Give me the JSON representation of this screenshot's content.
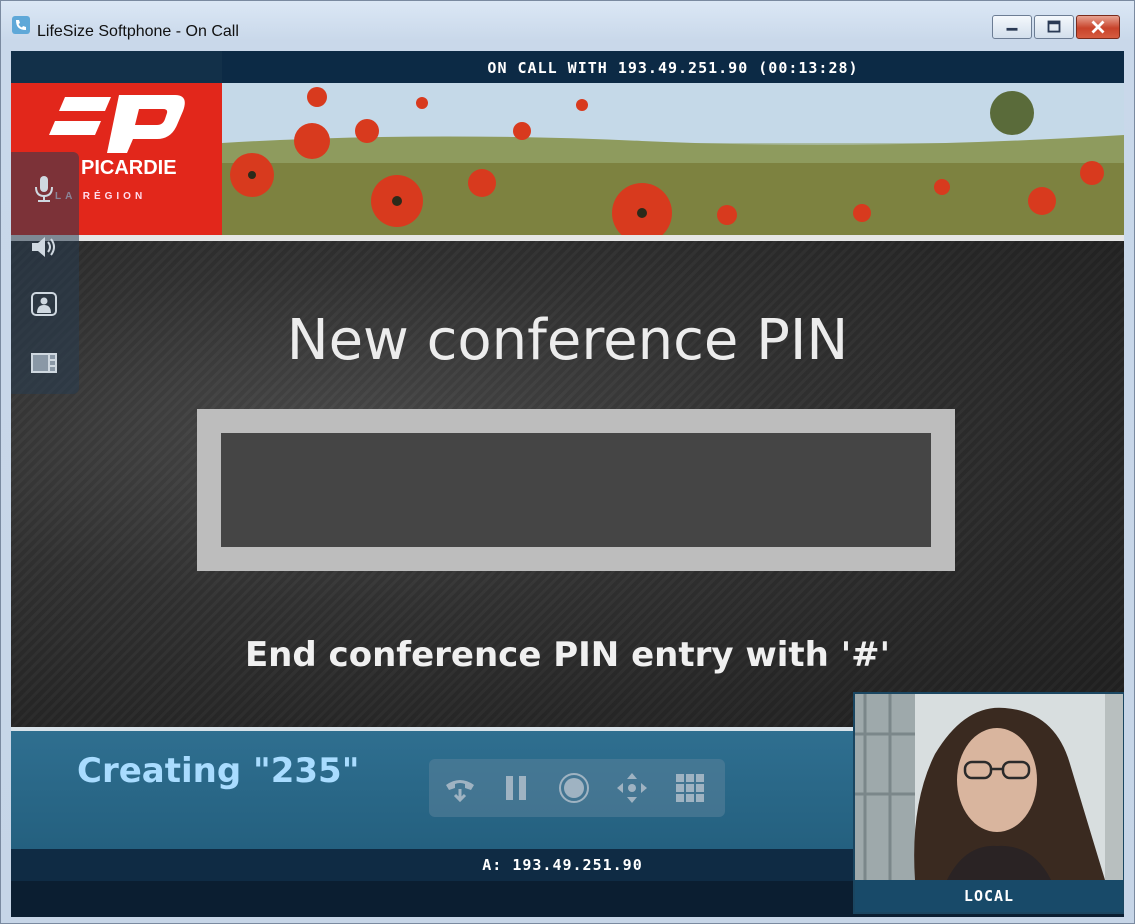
{
  "window": {
    "title": "LifeSize Softphone - On Call",
    "icon": "phone-app-icon"
  },
  "call": {
    "banner": "ON CALL WITH 193.49.251.90 (00:13:28)",
    "address": "A: 193.49.251.90"
  },
  "logo": {
    "name": "PICARDIE",
    "tagline": "LA RÉGION"
  },
  "prompt": {
    "title": "New conference PIN",
    "pin_value": "",
    "hint": "End conference PIN entry with '#'"
  },
  "status": {
    "text": "Creating \"235\""
  },
  "side_controls": [
    {
      "icon": "microphone-icon"
    },
    {
      "icon": "speaker-icon"
    },
    {
      "icon": "presentation-icon"
    },
    {
      "icon": "layout-icon"
    }
  ],
  "call_controls": [
    {
      "icon": "hang-up-icon"
    },
    {
      "icon": "pause-icon"
    },
    {
      "icon": "record-icon"
    },
    {
      "icon": "move-icon"
    },
    {
      "icon": "keypad-icon"
    }
  ],
  "local_video": {
    "label": "LOCAL"
  },
  "colors": {
    "accent": "#2f6f90",
    "logo_red": "#e2271b",
    "status_text": "#a9dcff"
  }
}
